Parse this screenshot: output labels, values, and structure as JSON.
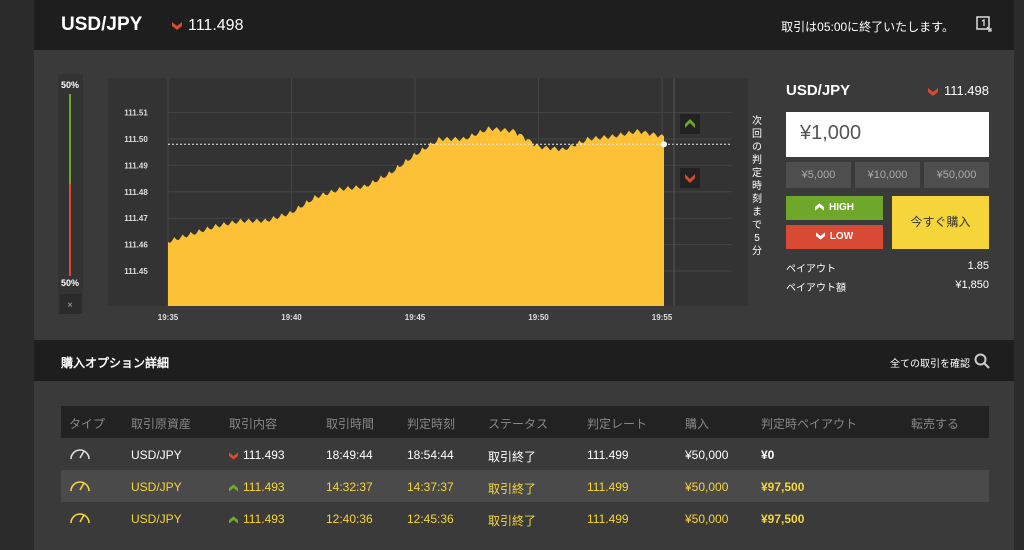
{
  "header": {
    "pair": "USD/JPY",
    "rate": "111.498",
    "notice": "取引は05:00に終了いたします。"
  },
  "chart": {
    "y_ticks": [
      "111.51",
      "111.50",
      "111.49",
      "111.48",
      "111.47",
      "111.46",
      "111.45"
    ],
    "x_ticks": [
      "19:35",
      "19:40",
      "19:45",
      "19:50",
      "19:55"
    ],
    "side_top": "50%",
    "side_bottom": "50%",
    "close_label": "×",
    "countdown": "次回の判定時刻まで5分",
    "current_rate": 111.498,
    "colors": {
      "area": "#fcc136",
      "high": "#6fa72a",
      "low": "#d94a34"
    }
  },
  "chart_data": {
    "type": "area",
    "x": [
      "19:34",
      "19:35",
      "19:36",
      "19:37",
      "19:38",
      "19:39",
      "19:40",
      "19:41",
      "19:42",
      "19:43",
      "19:44",
      "19:45",
      "19:46",
      "19:47",
      "19:48",
      "19:49",
      "19:50",
      "19:51",
      "19:52",
      "19:53",
      "19:54"
    ],
    "values": [
      111.461,
      111.464,
      111.467,
      111.469,
      111.469,
      111.472,
      111.478,
      111.481,
      111.482,
      111.487,
      111.494,
      111.5,
      111.5,
      111.504,
      111.503,
      111.497,
      111.496,
      111.5,
      111.501,
      111.503,
      111.501
    ],
    "ylim": [
      111.44,
      111.52
    ],
    "xlabel": "",
    "ylabel": ""
  },
  "trade": {
    "pair": "USD/JPY",
    "rate": "111.498",
    "amount": "¥1,000",
    "presets": [
      "¥5,000",
      "¥10,000",
      "¥50,000"
    ],
    "high_label": "HIGH",
    "low_label": "LOW",
    "buy_label": "今すぐ購入",
    "payout_label": "ペイアウト",
    "payout_value": "1.85",
    "payout_amount_label": "ペイアウト額",
    "payout_amount_value": "¥1,850"
  },
  "section": {
    "title": "購入オプション詳細",
    "link": "全ての取引を確認"
  },
  "table": {
    "headers": [
      "タイプ",
      "取引原資産",
      "取引内容",
      "取引時間",
      "判定時刻",
      "ステータス",
      "判定レート",
      "購入",
      "判定時ペイアウト",
      "転売する"
    ],
    "rows": [
      {
        "asset": "USD/JPY",
        "direction": "low",
        "rate": "111.493",
        "time": "18:49:44",
        "judge": "18:54:44",
        "status": "取引終了",
        "judge_rate": "111.499",
        "purchase": "¥50,000",
        "payout": "¥0",
        "color": "#ffffff"
      },
      {
        "asset": "USD/JPY",
        "direction": "high",
        "rate": "111.493",
        "time": "14:32:37",
        "judge": "14:37:37",
        "status": "取引終了",
        "judge_rate": "111.499",
        "purchase": "¥50,000",
        "payout": "¥97,500",
        "color": "#f6d53b"
      },
      {
        "asset": "USD/JPY",
        "direction": "high",
        "rate": "111.493",
        "time": "12:40:36",
        "judge": "12:45:36",
        "status": "取引終了",
        "judge_rate": "111.499",
        "purchase": "¥50,000",
        "payout": "¥97,500",
        "color": "#f6d53b"
      }
    ]
  }
}
